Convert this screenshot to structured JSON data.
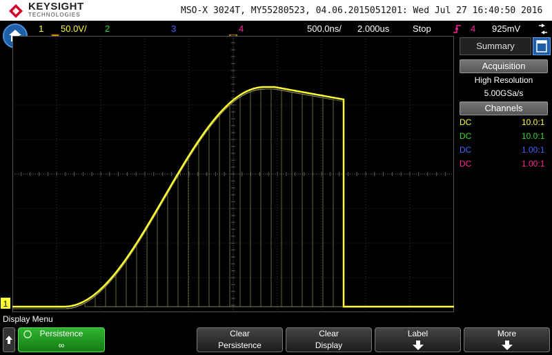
{
  "brand": {
    "name": "KEYSIGHT",
    "sub": "TECHNOLOGIES"
  },
  "window_title": "MSO-X 3024T, MY55280523, 04.06.2015051201: Wed Jul 27 16:40:50 2016",
  "status": {
    "ch1_num": "1",
    "ch1_scale": "50.0V/",
    "ch2_num": "2",
    "ch3_num": "3",
    "ch4_num": "4",
    "time_delay": "500.0ns/",
    "time_scale": "2.000us",
    "run_state": "Stop",
    "trigger_ch": "4",
    "trigger_level": "925mV"
  },
  "sidebar": {
    "tab_summary": "Summary",
    "acq_header": "Acquisition",
    "acq_mode": "High Resolution",
    "acq_rate": "5.00GSa/s",
    "ch_header": "Channels",
    "channels": [
      {
        "coupling": "DC",
        "probe": "10.0:1",
        "color": "#ffff33"
      },
      {
        "coupling": "DC",
        "probe": "10.0:1",
        "color": "#33dd33"
      },
      {
        "coupling": "DC",
        "probe": "1.00:1",
        "color": "#4466ff"
      },
      {
        "coupling": "DC",
        "probe": "1.00:1",
        "color": "#ff2299"
      }
    ]
  },
  "menu": {
    "title": "Display Menu",
    "persistence_label": "Persistence",
    "persistence_value": "∞",
    "clear_persistence_1": "Clear",
    "clear_persistence_2": "Persistence",
    "clear_display_1": "Clear",
    "clear_display_2": "Display",
    "label_btn": "Label",
    "more_btn": "More"
  },
  "colors": {
    "ch1": "#ffff33",
    "ch2": "#33dd33",
    "ch3": "#4466ff",
    "ch4": "#ff2299",
    "trace_dim": "#8a8a50"
  }
}
